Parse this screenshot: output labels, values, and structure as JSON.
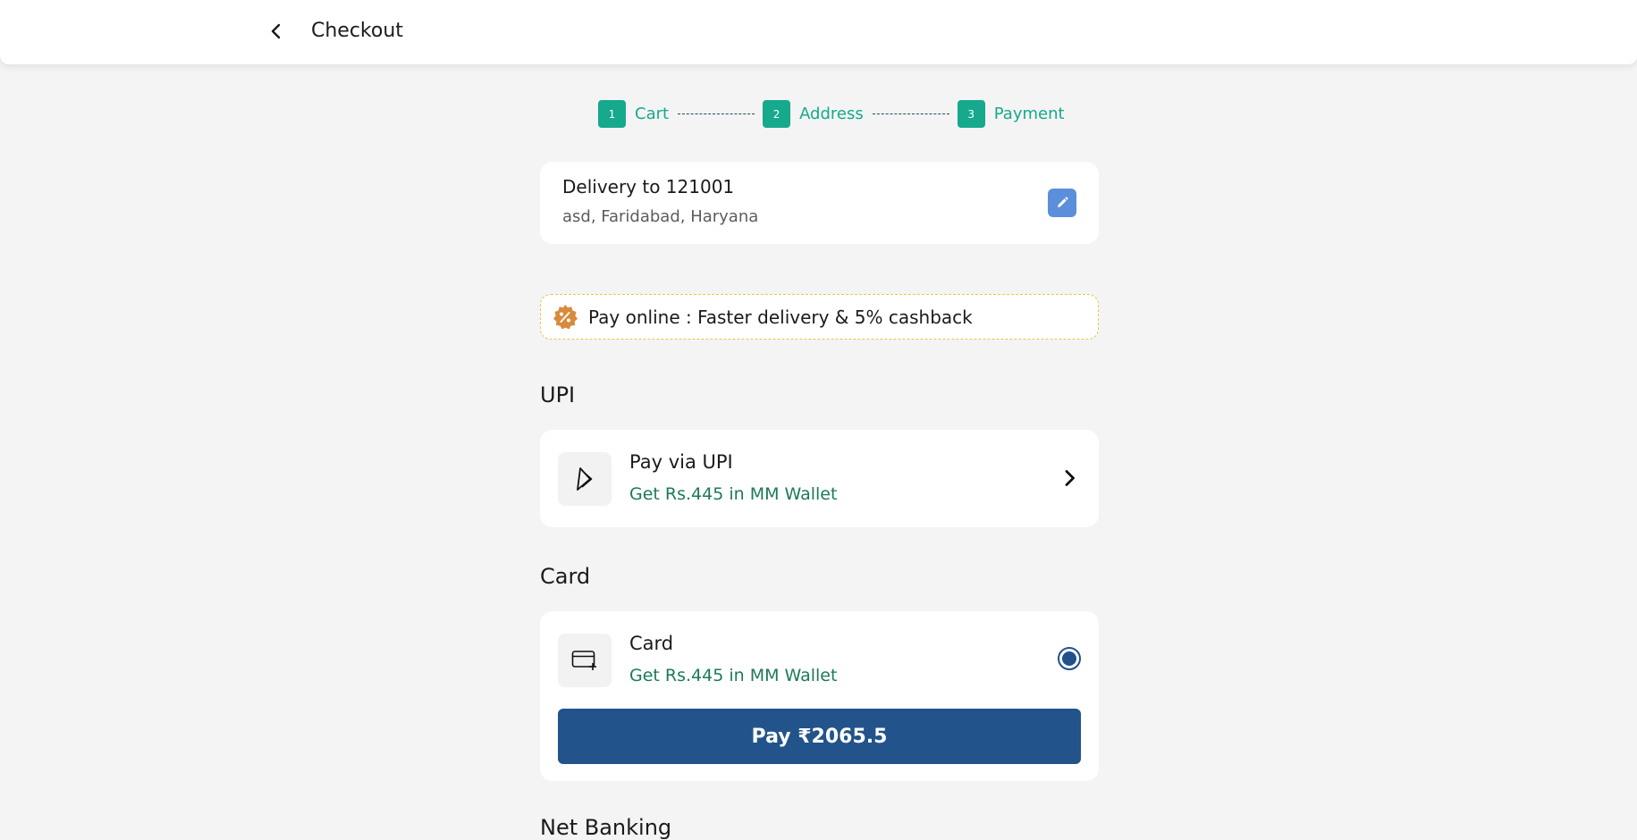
{
  "header": {
    "title": "Checkout"
  },
  "stepper": {
    "steps": [
      {
        "number": "1",
        "label": "Cart"
      },
      {
        "number": "2",
        "label": "Address"
      },
      {
        "number": "3",
        "label": "Payment"
      }
    ],
    "accent_color": "#16a98c"
  },
  "delivery": {
    "title": "Delivery to 121001",
    "address": "asd, Faridabad, Haryana"
  },
  "promo": {
    "text": "Pay online : Faster delivery & 5% cashback",
    "icon": "discount-badge-icon"
  },
  "sections": {
    "upi": {
      "heading": "UPI",
      "option_title": "Pay via UPI",
      "option_subtitle": "Get Rs.445 in MM Wallet",
      "icon": "upi-icon"
    },
    "card": {
      "heading": "Card",
      "option_title": "Card",
      "option_subtitle": "Get Rs.445 in MM Wallet",
      "icon": "credit-card-icon",
      "selected": true,
      "pay_button_label": "Pay ₹2065.5"
    },
    "next_heading": "Net Banking"
  },
  "colors": {
    "primary_button": "#22538a",
    "subtitle_green": "#1c7a5a",
    "edit_button": "#5b8fdb"
  }
}
